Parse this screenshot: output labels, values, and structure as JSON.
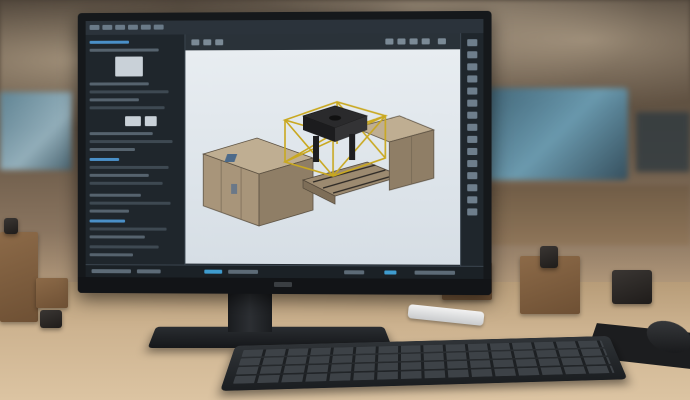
{
  "scene": {
    "description_kind": "photo",
    "subject": "cad-workstation"
  },
  "monitor": {
    "screen_app": "cad-application",
    "viewport_model": "industrial-enclosure-assembly"
  },
  "colors": {
    "screen_bg": "#232a31",
    "viewport_bg": "#e2e8ed",
    "accent_blue": "#3f9ccf",
    "frame_yellow": "#c9a820",
    "box_tan": "#a8957a",
    "desk_wood": "#cdb390"
  },
  "icons": {
    "toolbar": "toolbar-icons",
    "panel": "tool-panel-icons"
  }
}
